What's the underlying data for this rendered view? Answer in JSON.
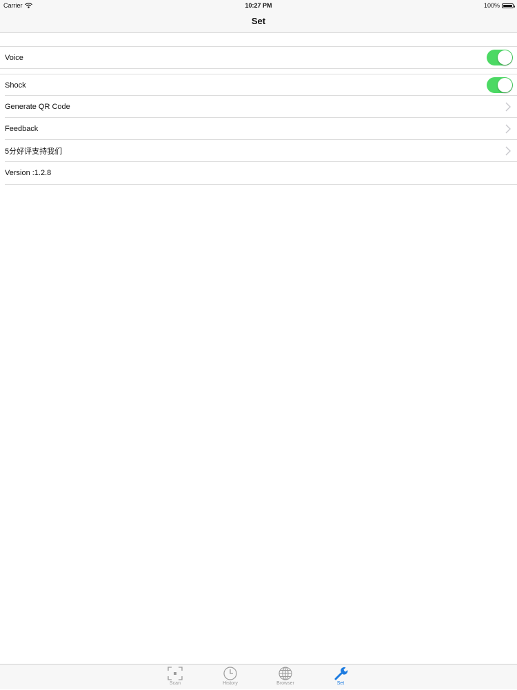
{
  "status_bar": {
    "carrier": "Carrier",
    "time": "10:27 PM",
    "battery": "100%"
  },
  "nav": {
    "title": "Set"
  },
  "settings": {
    "voice_label": "Voice",
    "voice_on": true,
    "shock_label": "Shock",
    "shock_on": true,
    "qr_label": "Generate QR Code",
    "feedback_label": "Feedback",
    "rate_label": "5分好评支持我们",
    "version_text": "Version :1.2.8"
  },
  "tabs": [
    {
      "label": "Scan",
      "icon": "scan-icon",
      "active": false
    },
    {
      "label": "History",
      "icon": "clock-icon",
      "active": false
    },
    {
      "label": "Browser",
      "icon": "globe-icon",
      "active": false
    },
    {
      "label": "Set",
      "icon": "wrench-icon",
      "active": true
    }
  ],
  "colors": {
    "accent": "#1e7ce0",
    "toggle_on": "#4cd964",
    "bar_bg": "#f7f7f7"
  }
}
